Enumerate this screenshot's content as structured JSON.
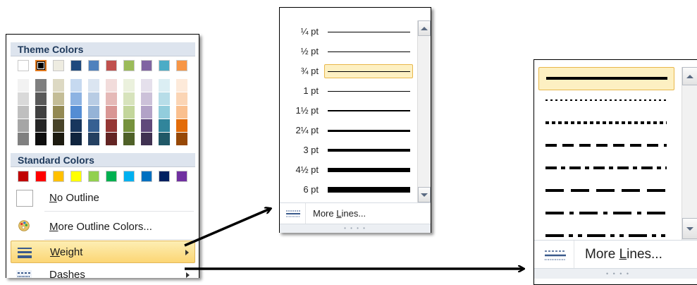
{
  "outline_menu": {
    "theme_colors_heading": "Theme Colors",
    "standard_colors_heading": "Standard Colors",
    "theme_top": [
      "#ffffff",
      "#000000",
      "#eeece1",
      "#1f497d",
      "#4f81bd",
      "#c0504d",
      "#9bbb59",
      "#8064a2",
      "#4bacc6",
      "#f79646"
    ],
    "theme_shades": [
      [
        "#f2f2f2",
        "#d9d9d9",
        "#bfbfbf",
        "#a6a6a6",
        "#808080"
      ],
      [
        "#7f7f7f",
        "#595959",
        "#404040",
        "#262626",
        "#0d0d0d"
      ],
      [
        "#ddd9c3",
        "#c4bd97",
        "#938953",
        "#494429",
        "#1d1b10"
      ],
      [
        "#c6d9f0",
        "#8db3e2",
        "#548dd4",
        "#17365d",
        "#0f243e"
      ],
      [
        "#dbe5f1",
        "#b8cce4",
        "#95b3d7",
        "#366092",
        "#244061"
      ],
      [
        "#f2dcdb",
        "#e5b9b7",
        "#d99694",
        "#953734",
        "#632423"
      ],
      [
        "#ebf1dd",
        "#d7e3bc",
        "#c3d69b",
        "#76923c",
        "#4f6128"
      ],
      [
        "#e5e0ec",
        "#ccc1d9",
        "#b2a2c7",
        "#5f497a",
        "#3f3151"
      ],
      [
        "#dbeef3",
        "#b7dde8",
        "#92cddc",
        "#31859b",
        "#205867"
      ],
      [
        "#fdeada",
        "#fbd5b5",
        "#fac08f",
        "#e36c09",
        "#974806"
      ]
    ],
    "standard": [
      "#c00000",
      "#ff0000",
      "#ffc000",
      "#ffff00",
      "#92d050",
      "#00b050",
      "#00b0f0",
      "#0070c0",
      "#002060",
      "#7030a0"
    ],
    "no_outline": "No Outline",
    "more_colors": "More Outline Colors...",
    "weight": "Weight",
    "dashes": "Dashes"
  },
  "weight_menu": {
    "items": [
      {
        "label": "¼ pt",
        "w": 0.25
      },
      {
        "label": "½ pt",
        "w": 0.5
      },
      {
        "label": "¾ pt",
        "w": 0.75,
        "selected": true
      },
      {
        "label": "1 pt",
        "w": 1
      },
      {
        "label": "1½ pt",
        "w": 1.5
      },
      {
        "label": "2¼ pt",
        "w": 2.25
      },
      {
        "label": "3 pt",
        "w": 3
      },
      {
        "label": "4½ pt",
        "w": 4.5
      },
      {
        "label": "6 pt",
        "w": 6
      }
    ],
    "more_lines": "More Lines..."
  },
  "dashes_menu": {
    "styles": [
      "solid",
      "square-dot",
      "round-dot",
      "dash",
      "dash-dot",
      "long-dash",
      "long-dash-dot",
      "long-dash-dot-dot"
    ],
    "more_lines": "More Lines..."
  },
  "accent_highlight": "#fcd675"
}
